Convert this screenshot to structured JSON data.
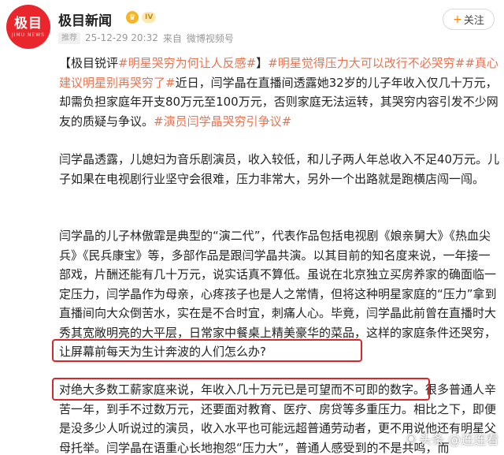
{
  "header": {
    "avatar_text": "极目",
    "avatar_sub": "JIMU NEWS",
    "account_name": "极目新闻",
    "vip_icon": "crown-icon",
    "level_badge": "IV",
    "recommend_badge": "推荐",
    "timestamp": "25-12-29 20:32",
    "source_prefix": "来自",
    "source": "微博视频号",
    "follow_label": "关注"
  },
  "post": {
    "p1_tag": "【极目锐评",
    "p1_topic1": "#明星哭穷为何让人反感#",
    "p1_bracket": "】",
    "p1_topic2": "#明星觉得压力大可以改行不必哭穷#",
    "p1_topic3": "#真心建议明星别再哭穷了#",
    "p1_text": "近日，闫学晶在直播间透露她32岁的儿子年收入仅几十万元，却需负担家庭年开支80万元至100万元，否则家庭无法运转，其哭穷内容引发不少网友的质疑与争议。",
    "p1_topic4": "#演员闫学晶哭穷引争议#",
    "p2": "闫学晶透露，儿媳妇为音乐剧演员，收入较低，和儿子两人年总收入不足40万元。儿子如果在电视剧行业坚守会很难，压力非常大，另外一个出路就是跑横店闯一闯。",
    "p3_a": "闫学晶的儿子林傲霏是典型的“演二代”，代表作品包括电视剧《娘亲舅大》《热血尖兵》《民兵康宝》等，多部作品是跟闫学晶共演。以其目前的知名度来说，一年接一部戏，片酬还能有几十万元，说实话真不算低。虽说在北京独立买房养家的确面临一定压力，闫学晶作为母亲，心疼孩子也是人之常情，但将这种明星家庭的“压力”拿到直播间向大众倒苦水，实在是不合时宜，刺痛人心。毕竟，闫学晶此前曾在直播时大秀其宽敞明亮的大平层，日常家中餐桌上精美豪华的菜品，这样的家",
    "p3_b": "庭条件还哭穷，让屏幕前每天为生计奔波的人们怎么办?",
    "p4_a": "对绝大多数工薪家庭来说，年收入几十万元已是可望而不可即的数字。",
    "p4_b": "很多普通人辛苦一年，到手不过数万元，还要面对教育、医疗、房贷等多重压力。相比之下，即便是没多少人听说过的演员，收入水平也可能远超普通劳动者，更不用说他还有明星父母托举。闫学晶在语重心长地抱怨“压力大”，普通人感受到的不是共鸣，而"
  },
  "watermark": {
    "text": "头条 @连连看",
    "icon": "camera-icon"
  },
  "colors": {
    "accent_topic": "#eb7350",
    "highlight_box": "#d9262b",
    "avatar_bg": "#e8262b",
    "follow_plus": "#ff8200"
  }
}
